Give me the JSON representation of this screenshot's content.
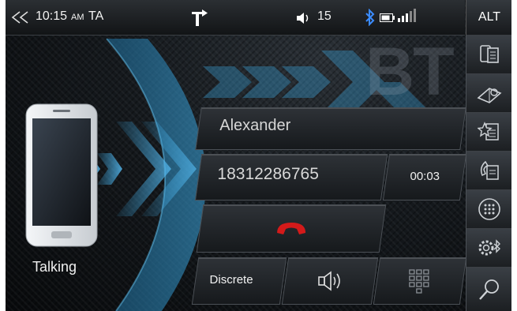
{
  "status": {
    "time": "10:15",
    "ampm": "AM",
    "ta": "TA",
    "volume": "15",
    "alt_label": "ALT",
    "icons": [
      "back-arrows-icon",
      "turn-arrow-icon",
      "speaker-icon",
      "bluetooth-icon",
      "battery-icon",
      "signal-icon"
    ]
  },
  "watermark": "BT",
  "call": {
    "name": "Alexander",
    "number": "18312286765",
    "duration": "00:03",
    "status": "Talking"
  },
  "controls": {
    "discrete_label": "Discrete"
  },
  "sidebar": {
    "items": [
      "phone-list-icon",
      "phonebook-icon",
      "favorites-icon",
      "call-history-icon",
      "dialpad-icon",
      "bt-settings-icon",
      "search-icon"
    ]
  },
  "colors": {
    "accent_blue": "#3aa6df",
    "hangup_red": "#d41a1a",
    "bluetooth": "#3b8cff"
  }
}
